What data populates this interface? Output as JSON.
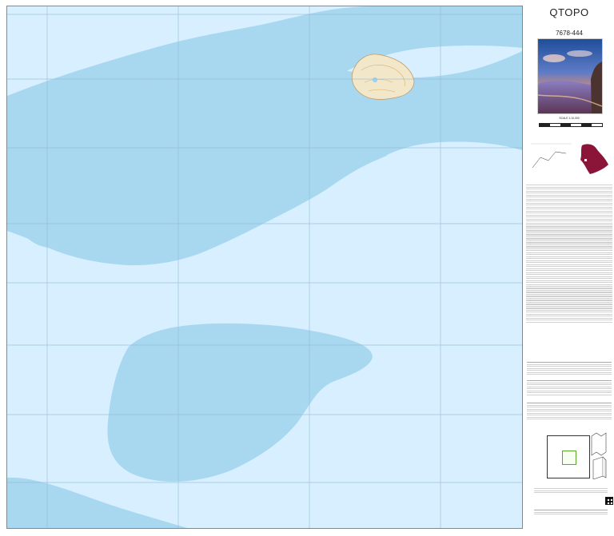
{
  "map": {
    "top_coords": [
      "",
      "",
      "",
      "",
      ""
    ],
    "bottom_coords": [
      "",
      "",
      "",
      "",
      ""
    ],
    "left_coords": [
      "",
      "",
      "",
      "",
      "",
      "",
      "",
      "",
      ""
    ],
    "right_coords": [
      "",
      "",
      "",
      "",
      "",
      "",
      "",
      "",
      ""
    ],
    "colors": {
      "deep_water": "#a8d7f0",
      "shallow_water": "#d8efff",
      "island_land": "#f2e7c8",
      "island_relief": "#d6b06d",
      "grid": "#8fbad4"
    }
  },
  "panel": {
    "title": "QTOPO",
    "sheet_number": "7678-444",
    "scale_label": "SCALE 1:10,000"
  }
}
